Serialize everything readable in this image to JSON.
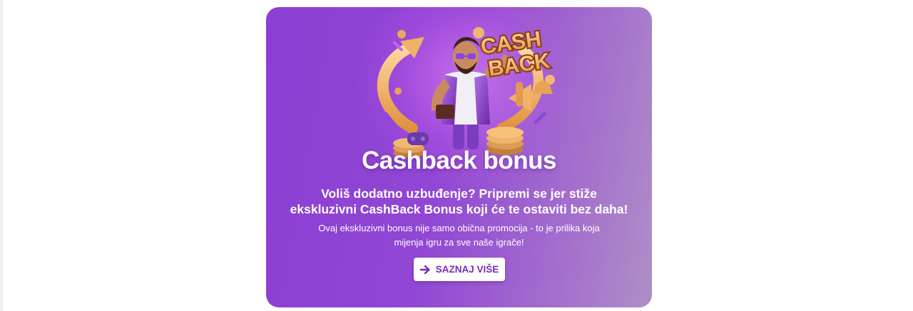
{
  "promo": {
    "title": "Cashback bonus",
    "subtitle_line1": "Voliš dodatno uzbuđenje? Pripremi se jer stiže",
    "subtitle_line2": "ekskluzivni CashBack Bonus koji će te ostaviti bez daha!",
    "body_line1": "Ovaj ekskluzivni bonus nije samo obična promocija - to je prilika koja",
    "body_line2": "mijenja igru za sve naše igrače!",
    "cta_label": "SAZNAJ VIŠE",
    "cta_icon": "arrow-right-icon"
  },
  "hero": {
    "logo_line1": "CASH",
    "logo_line2": "BACK"
  },
  "colors": {
    "card_start": "#8b3fd3",
    "card_end": "#ae8fc6",
    "cta_text": "#7a2bb8",
    "logo_gold": "#f2b25c"
  }
}
